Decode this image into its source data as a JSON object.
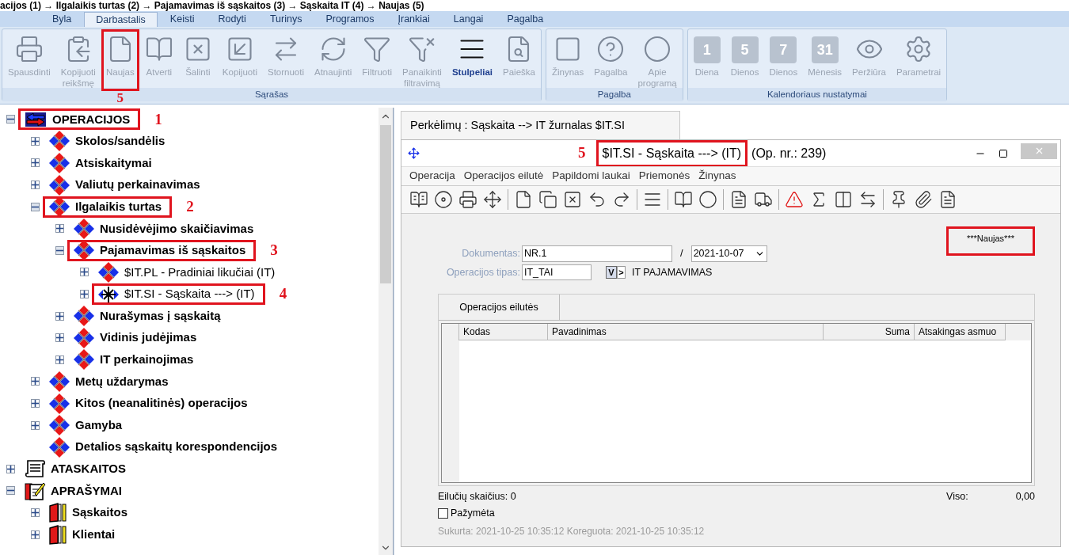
{
  "caption": "acijos (1) → Ilgalaikis turtas (2) → Pajamavimas iš sąskaitos (3) → Sąskaita IT (4) → Naujas (5)",
  "ribbon_tabs": [
    {
      "label": "Byla",
      "selected": false
    },
    {
      "label": "Darbastalis",
      "selected": true
    },
    {
      "label": "Keisti",
      "selected": false
    },
    {
      "label": "Rodyti",
      "selected": false
    },
    {
      "label": "Turinys",
      "selected": false
    },
    {
      "label": "Programos",
      "selected": false
    },
    {
      "label": "Įrankiai",
      "selected": false
    },
    {
      "label": "Langai",
      "selected": false
    },
    {
      "label": "Pagalba",
      "selected": false
    }
  ],
  "ribbon_groups": [
    {
      "title": "Sąrašas",
      "buttons": [
        {
          "lines": [
            "Spausdinti"
          ],
          "disabled": true,
          "highlighted": false
        },
        {
          "lines": [
            "Kopijuoti",
            "reikšmę"
          ],
          "disabled": true,
          "highlighted": false
        },
        {
          "lines": [
            "Naujas"
          ],
          "disabled": true,
          "highlighted": true,
          "callout": "5"
        },
        {
          "lines": [
            "Atverti"
          ],
          "disabled": true,
          "highlighted": false
        },
        {
          "lines": [
            "Šalinti"
          ],
          "disabled": true,
          "highlighted": false
        },
        {
          "lines": [
            "Kopijuoti"
          ],
          "disabled": true,
          "highlighted": false
        },
        {
          "lines": [
            "Stornuoti"
          ],
          "disabled": true,
          "highlighted": false
        },
        {
          "lines": [
            "Atnaujinti"
          ],
          "disabled": true,
          "highlighted": false
        },
        {
          "lines": [
            "Filtruoti"
          ],
          "disabled": true,
          "highlighted": false
        },
        {
          "lines": [
            "Panaikinti",
            "filtravimą"
          ],
          "disabled": true,
          "highlighted": false
        },
        {
          "lines": [
            "Stulpeliai"
          ],
          "disabled": false,
          "highlighted": false
        },
        {
          "lines": [
            "Paieška"
          ],
          "disabled": true,
          "highlighted": false
        }
      ]
    },
    {
      "title": "Pagalba",
      "buttons": [
        {
          "lines": [
            "Žinynas"
          ],
          "disabled": true,
          "highlighted": false
        },
        {
          "lines": [
            "Pagalba"
          ],
          "disabled": true,
          "highlighted": false
        },
        {
          "lines": [
            "Apie",
            "programą"
          ],
          "disabled": true,
          "highlighted": false
        }
      ]
    },
    {
      "title": "Kalendoriaus nustatymai",
      "buttons": [
        {
          "number": "1",
          "lines": [
            "Diena"
          ],
          "disabled": true,
          "highlighted": false
        },
        {
          "number": "5",
          "lines": [
            "Dienos"
          ],
          "disabled": true,
          "highlighted": false
        },
        {
          "number": "7",
          "lines": [
            "Dienos"
          ],
          "disabled": true,
          "highlighted": false
        },
        {
          "number": "31",
          "lines": [
            "Mėnesis"
          ],
          "disabled": true,
          "highlighted": false
        },
        {
          "lines": [
            "Peržiūra"
          ],
          "disabled": true,
          "highlighted": false
        },
        {
          "lines": [
            "Parametrai"
          ],
          "disabled": true,
          "highlighted": false
        }
      ]
    }
  ],
  "tree": [
    {
      "label": "OPERACIJOS",
      "kind": "ops",
      "bold": true,
      "expanded": true,
      "highlighted": true,
      "callout": "1",
      "children": [
        {
          "label": "Skolos/sandėlis",
          "kind": "diamond",
          "bold": true,
          "expanded": false,
          "highlighted": false
        },
        {
          "label": "Atsiskaitymai",
          "kind": "diamond",
          "bold": true,
          "expanded": false,
          "highlighted": false
        },
        {
          "label": "Valiutų perkainavimas",
          "kind": "diamond",
          "bold": true,
          "expanded": false,
          "highlighted": false
        },
        {
          "label": "Ilgalaikis turtas",
          "kind": "diamond",
          "bold": true,
          "expanded": true,
          "highlighted": true,
          "callout": "2",
          "children": [
            {
              "label": "Nusidėvėjimo skaičiavimas",
              "kind": "diamond",
              "bold": true,
              "expanded": false,
              "highlighted": false
            },
            {
              "label": "Pajamavimas iš sąskaitos",
              "kind": "diamond",
              "bold": true,
              "expanded": true,
              "highlighted": true,
              "callout": "3",
              "children": [
                {
                  "label": "$IT.PL - Pradiniai likučiai (IT)",
                  "kind": "diamond",
                  "bold": false,
                  "expanded": false,
                  "highlighted": false
                },
                {
                  "label": "$IT.SI - Sąskaita ---> (IT)",
                  "kind": "cross",
                  "bold": false,
                  "expanded": false,
                  "highlighted": true,
                  "callout": "4"
                }
              ]
            },
            {
              "label": "Nurašymas į sąskaitą",
              "kind": "diamond",
              "bold": true,
              "expanded": false,
              "highlighted": false
            },
            {
              "label": "Vidinis judėjimas",
              "kind": "diamond",
              "bold": true,
              "expanded": false,
              "highlighted": false
            },
            {
              "label": "IT perkainojimas",
              "kind": "diamond",
              "bold": true,
              "expanded": false,
              "highlighted": false
            }
          ]
        },
        {
          "label": "Metų uždarymas",
          "kind": "diamond",
          "bold": true,
          "expanded": false,
          "highlighted": false
        },
        {
          "label": "Kitos (neanalitinės) operacijos",
          "kind": "diamond",
          "bold": true,
          "expanded": false,
          "highlighted": false
        },
        {
          "label": "Gamyba",
          "kind": "diamond",
          "bold": true,
          "expanded": false,
          "highlighted": false
        },
        {
          "label": "Detalios sąskaitų korespondencijos",
          "kind": "diamond",
          "bold": true,
          "highlighted": false
        }
      ]
    },
    {
      "label": "ATASKAITOS",
      "kind": "scroll",
      "bold": true,
      "expanded": false,
      "highlighted": false
    },
    {
      "label": "APRAŠYMAI",
      "kind": "notepad",
      "bold": true,
      "expanded": true,
      "highlighted": false,
      "children": [
        {
          "label": "Sąskaitos",
          "kind": "book",
          "bold": true,
          "expanded": false,
          "highlighted": false
        },
        {
          "label": "Klientai",
          "kind": "book",
          "bold": true,
          "expanded": false,
          "highlighted": false
        }
      ]
    }
  ],
  "doc_tab": "Perkėlimų : Sąskaita --> IT žurnalas $IT.SI",
  "window": {
    "callout": "5",
    "title": "$IT.SI - Sąskaita ---> (IT)",
    "title_highlighted": true,
    "title_suffix": "(Op. nr.: 239)",
    "menu": [
      "Operacija",
      "Operacijos eilutė",
      "Papildomi laukai",
      "Priemonės",
      "Žinynas"
    ],
    "status": "***Naujas***",
    "status_highlighted": true,
    "document_label": "Dokumentas:",
    "document_value": "NR.1",
    "separator": "/",
    "date_value": "2021-10-07",
    "type_label": "Operacijos tipas:",
    "type_value": "IT_TAI",
    "type_button": "V",
    "type_next": ">",
    "type_name": "IT PAJAMAVIMAS",
    "grid_tab": "Operacijos eilutės",
    "columns": [
      {
        "label": "Kodas",
        "kind": "text"
      },
      {
        "label": "Pavadinimas",
        "kind": "text"
      },
      {
        "label": "Suma",
        "kind": "number"
      },
      {
        "label": "Atsakingas asmuo",
        "kind": "text"
      }
    ],
    "row_count": "Eilučių skaičius: 0",
    "total_label": "Viso:",
    "total_value": "0,00",
    "marked": {
      "label": "Pažymėta",
      "checked": false
    },
    "audit": "Sukurta: 2021-10-25 10:35:12 Koreguota: 2021-10-25 10:35:12"
  }
}
